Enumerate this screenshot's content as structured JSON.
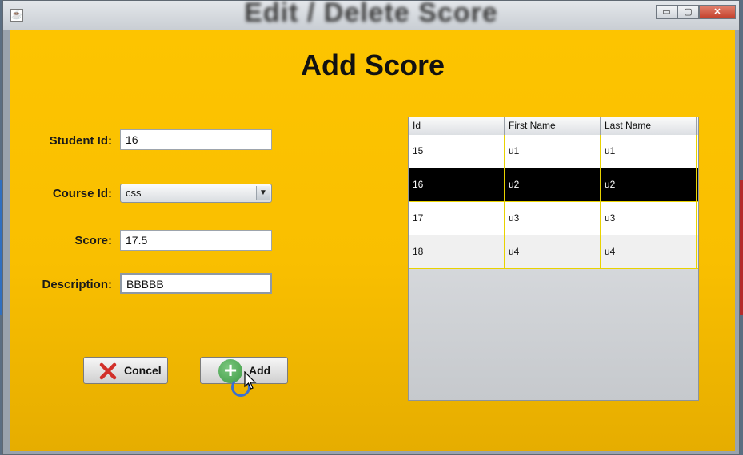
{
  "window": {
    "title": "Edit / Delete Score",
    "icon": "java-cup-icon",
    "controls": {
      "minimize": "▭",
      "maximize": "▢",
      "close": "✕"
    }
  },
  "form": {
    "heading": "Add Score",
    "student_id": {
      "label": "Student Id:",
      "value": "16"
    },
    "course_id": {
      "label": "Course Id:",
      "value": "css",
      "arrow": "▼"
    },
    "score": {
      "label": "Score:",
      "value": "17.5"
    },
    "description": {
      "label": "Description:",
      "value": "BBBBB"
    }
  },
  "buttons": {
    "cancel_label": "Concel",
    "add_label": "Add",
    "add_icon_glyph": "+"
  },
  "table": {
    "columns": [
      "Id",
      "First Name",
      "Last Name"
    ],
    "rows": [
      [
        "15",
        "u1",
        "u1"
      ],
      [
        "16",
        "u2",
        "u2"
      ],
      [
        "17",
        "u3",
        "u3"
      ],
      [
        "18",
        "u4",
        "u4"
      ]
    ],
    "selected_row": 1
  },
  "colors": {
    "panel": "#fdc400",
    "selected_row": "#000000",
    "grid_line": "#e8d200"
  }
}
